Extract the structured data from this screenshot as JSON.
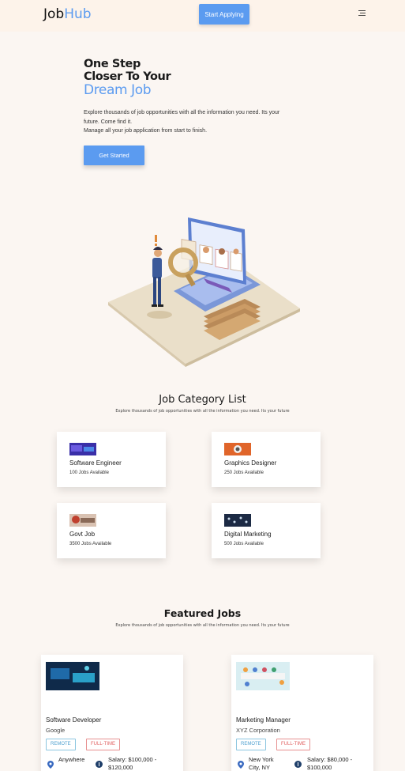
{
  "nav": {
    "logo_part1": "Job",
    "logo_part2": "Hub",
    "cta_label": "Start Applying",
    "menu_icon": "menu-icon"
  },
  "hero": {
    "title_line1": "One Step",
    "title_line2": "Closer To Your",
    "title_line3": "Dream Job",
    "desc_line1": "Explore thousands of job opportunities with all the information you need. Its your",
    "desc_line2": "future. Come find it.",
    "desc_line3": "Manage all your job application from start to finish.",
    "button_label": "Get Started"
  },
  "categories": {
    "title": "Job Category List",
    "subtitle": "Explore thousands of job opportunities with all the information you need. Its your future",
    "items": [
      {
        "name": "Software Engineer",
        "count": "100 Jobs Available"
      },
      {
        "name": "Graphics Designer",
        "count": "250 Jobs Available"
      },
      {
        "name": "Govt Job",
        "count": "3500 Jobs Available"
      },
      {
        "name": "Digital Marketing",
        "count": "500 Jobs Available"
      }
    ]
  },
  "featured": {
    "title": "Featured Jobs",
    "subtitle": "Explore thousands of job opportunities with all the information you need. Its your future",
    "jobs": [
      {
        "title": "Software Developer",
        "company": "Google",
        "tag1": "REMOTE",
        "tag2": "FULL-TIME",
        "location_line1": "Anywhere",
        "salary_line1": "Salary: $100,000 -",
        "salary_line2": "$120,000"
      },
      {
        "title": "Marketing Manager",
        "company": "XYZ Corporation",
        "tag1": "REMOTE",
        "tag2": "FULL-TIME",
        "location_line1": "New York",
        "location_line2": "City, NY",
        "salary_line1": "Salary: $80,000 -",
        "salary_line2": "$100,000"
      }
    ]
  },
  "colors": {
    "accent": "#5b9bf0",
    "background": "#fbf6f2",
    "nav_background": "#fdf3ea",
    "remote_tag": "#4fa0d0",
    "fulltime_tag": "#e06060"
  }
}
